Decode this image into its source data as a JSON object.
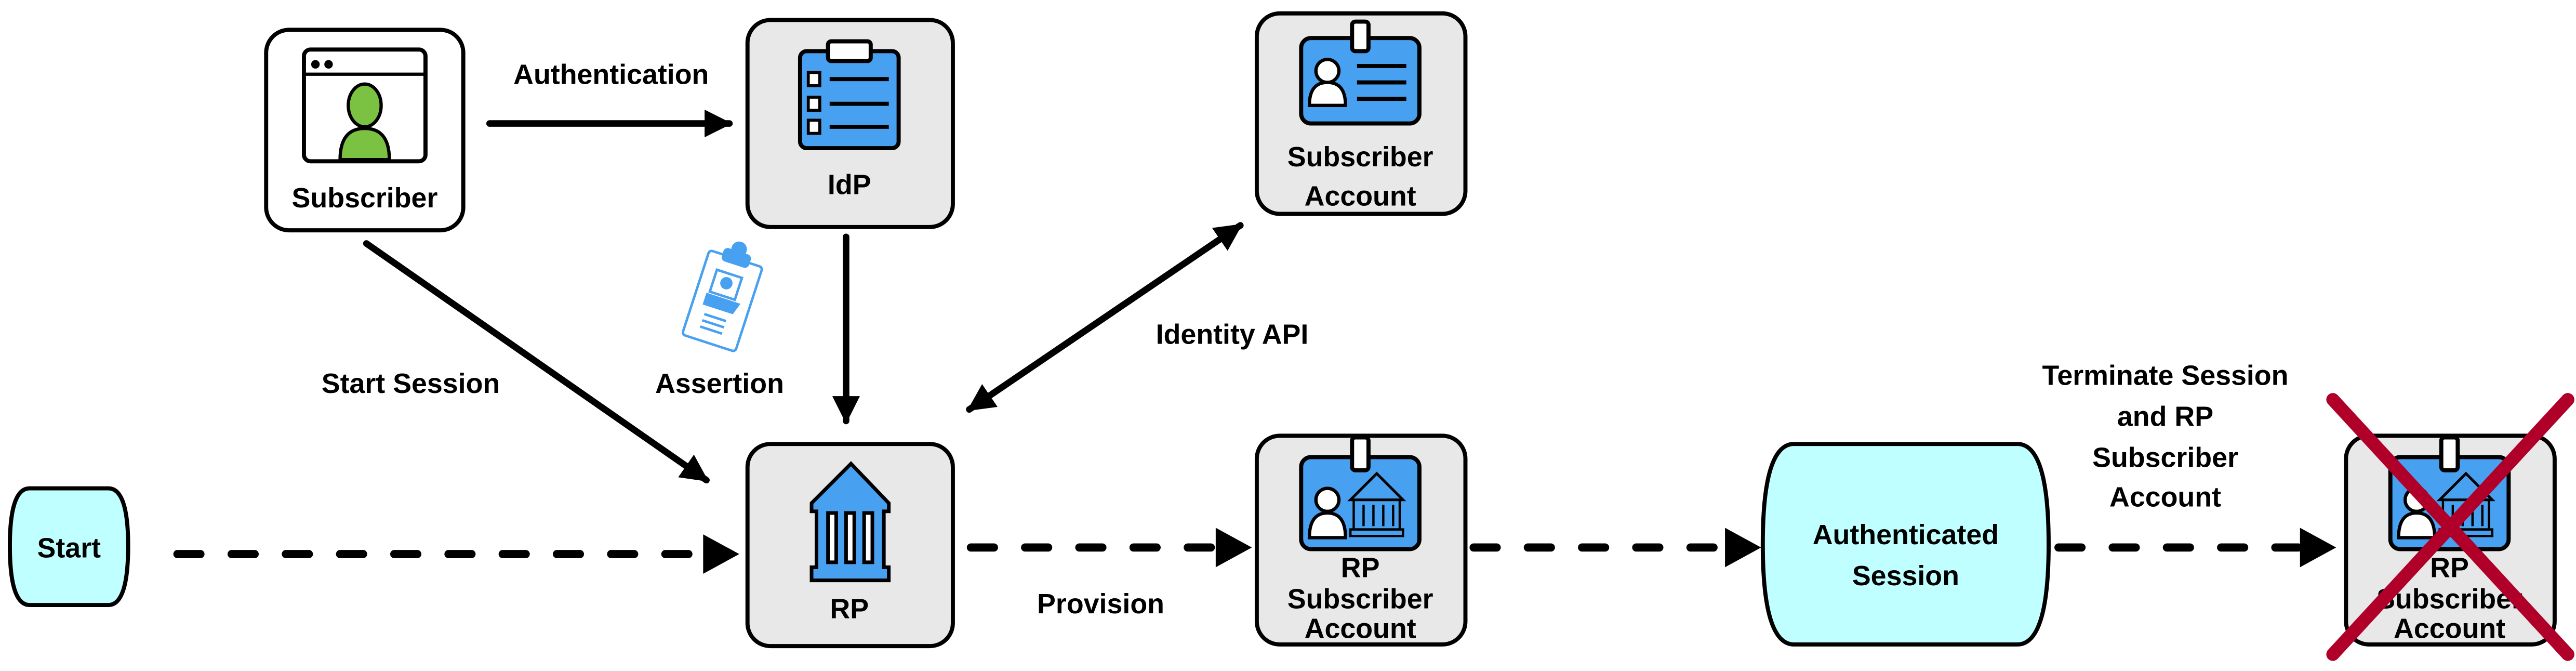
{
  "colors": {
    "node_fill": "#e8e8e8",
    "terminal_fill": "#bfffff",
    "icon_blue": "#47a0f0",
    "person_green": "#7cc242",
    "cross_red": "#b0002a"
  },
  "nodes": {
    "subscriber": {
      "label": "Subscriber",
      "icon": "browser-user-icon"
    },
    "idp": {
      "label": "IdP",
      "icon": "clipboard-checklist-icon"
    },
    "subscriber_account": {
      "line1": "Subscriber",
      "line2": "Account",
      "icon": "id-badge-icon"
    },
    "start": {
      "label": "Start"
    },
    "rp": {
      "label": "RP",
      "icon": "bank-building-icon"
    },
    "rp_subscriber_account": {
      "line1": "RP",
      "line2": "Subscriber",
      "line3": "Account",
      "icon": "id-badge-bank-icon"
    },
    "authenticated_session": {
      "line1": "Authenticated",
      "line2": "Session"
    },
    "terminated_rp_subscriber_account": {
      "line1": "RP",
      "line2": "Subscriber",
      "line3": "Account",
      "icon": "id-badge-bank-icon",
      "overlay": "red-x-icon"
    }
  },
  "edges": {
    "authentication": "Authentication",
    "start_session": "Start Session",
    "assertion": "Assertion",
    "identity_api": "Identity API",
    "provision": "Provision",
    "terminate": {
      "line1": "Terminate Session",
      "line2": "and RP",
      "line3": "Subscriber",
      "line4": "Account"
    }
  }
}
